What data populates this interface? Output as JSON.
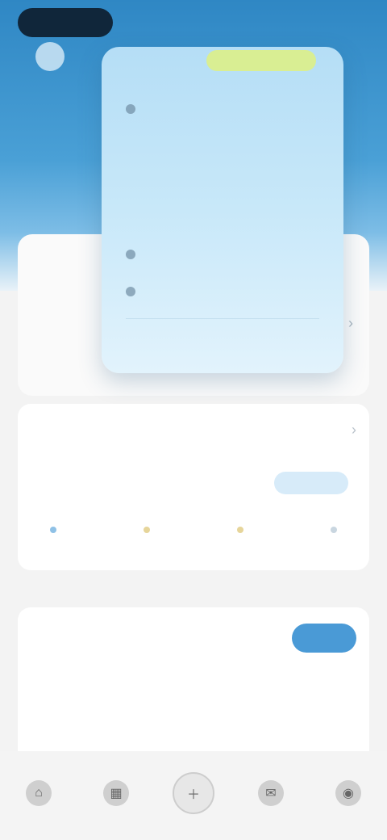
{
  "status": {
    "pill": "",
    "right": ""
  },
  "side": {
    "label": ""
  },
  "menu": {
    "highlight": "",
    "items": [
      {
        "label": "",
        "icon": "dot-icon"
      },
      {
        "label": "",
        "icon": "none"
      },
      {
        "label": "",
        "icon": "none"
      },
      {
        "label": "",
        "icon": "none"
      },
      {
        "label": "",
        "icon": "dot-icon"
      },
      {
        "label": "",
        "icon": "dot-icon"
      },
      {
        "label": "",
        "icon": "none"
      }
    ]
  },
  "under_card": {
    "tiny": "",
    "tiny_accent": ""
  },
  "schedule": {
    "title": "",
    "subtitle": "",
    "button": "",
    "days": [
      {
        "label": "",
        "dot_color": "#8fc1e6"
      },
      {
        "label": "",
        "dot_color": "#e6d59a"
      },
      {
        "label": "",
        "dot_color": "#e6d59a"
      },
      {
        "label": "",
        "dot_color": "#c9d6e0"
      }
    ]
  },
  "card2": {
    "title": "",
    "button": "",
    "link": "",
    "left_note": "",
    "right_note": ""
  },
  "tabbar": {
    "tabs": [
      {
        "label": "",
        "icon": "home-icon"
      },
      {
        "label": "",
        "icon": "calendar-icon"
      },
      {
        "label": "",
        "icon": "add-icon"
      },
      {
        "label": "",
        "icon": "chat-icon"
      },
      {
        "label": "",
        "icon": "profile-icon"
      }
    ]
  },
  "colors": {
    "accent": "#4a9ad6",
    "header": "#2f87c4",
    "highlight": "#d9ee93"
  }
}
